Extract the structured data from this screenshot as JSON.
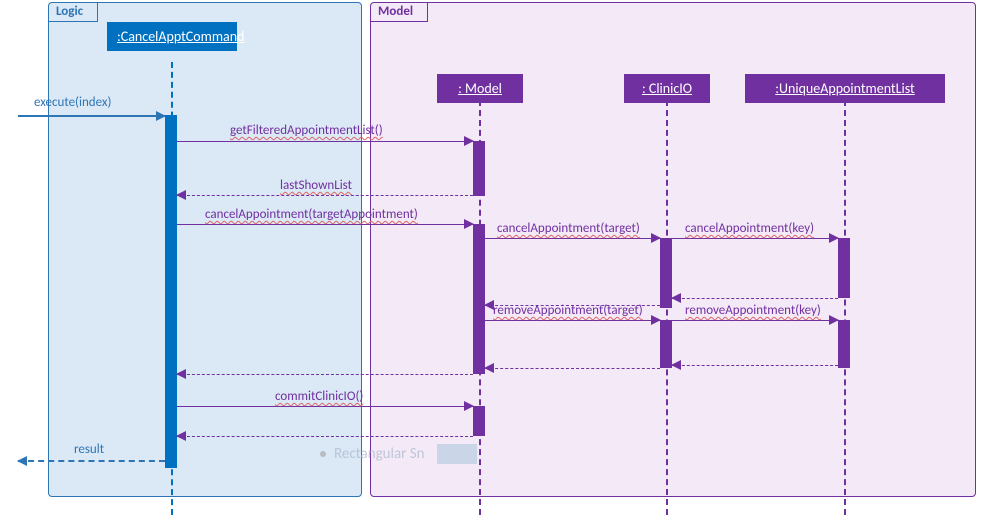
{
  "frames": {
    "logic": "Logic",
    "model": "Model"
  },
  "lifelines": {
    "cmd": ":CancelApptCommand",
    "model": ": Model",
    "clinicio": ": ClinicIO",
    "ual": ":UniqueAppointmentList"
  },
  "messages": {
    "execute": "execute(index)",
    "getFiltered": "getFilteredAppointmentList()",
    "lastShown": "lastShownList",
    "cancelTargetAppt": "cancelAppointment(targetAppointment)",
    "cancelTarget": "cancelAppointment(target)",
    "cancelKey": "cancelAppointment(key)",
    "removeTarget": "removeAppointment(target)",
    "removeKey": "removeAppointment(key)",
    "commit": "commitClinicIO()",
    "result": "result"
  },
  "watermark": "Rectangular Sn"
}
